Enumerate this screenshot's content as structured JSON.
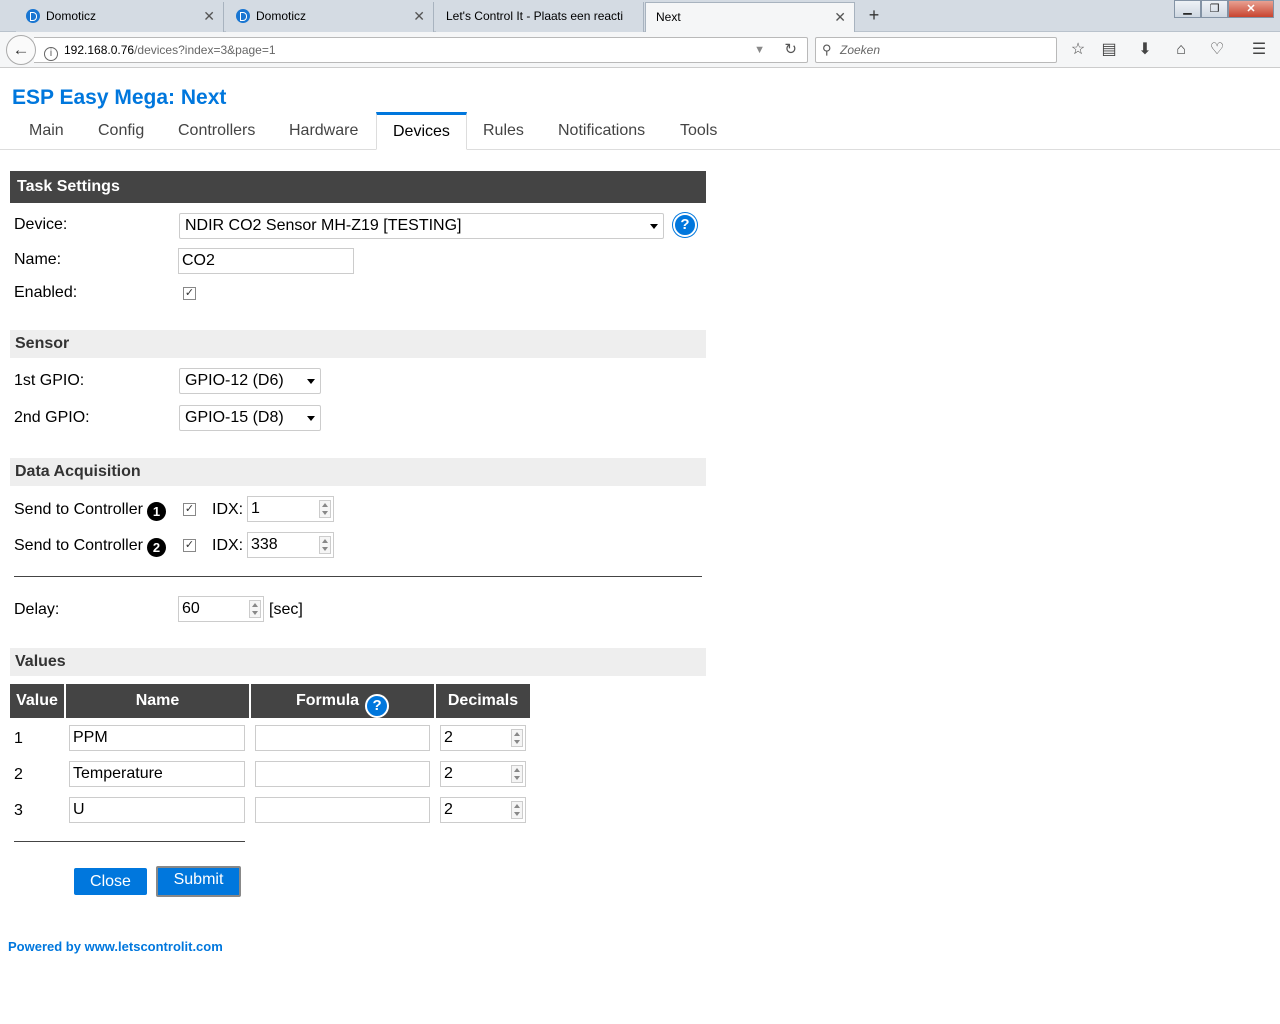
{
  "browser": {
    "tabs": [
      {
        "title": "Domoticz",
        "has_icon": true
      },
      {
        "title": "Domoticz",
        "has_icon": true
      },
      {
        "title": "Let's Control It - Plaats een reacti",
        "has_icon": false
      },
      {
        "title": "Next",
        "has_icon": false
      }
    ],
    "url_host": "192.168.0.76",
    "url_path": "/devices?index=3&page=1",
    "search_placeholder": "Zoeken"
  },
  "page": {
    "title": "ESP Easy Mega: Next",
    "menu": [
      "Main",
      "Config",
      "Controllers",
      "Hardware",
      "Devices",
      "Rules",
      "Notifications",
      "Tools"
    ],
    "active_menu": "Devices"
  },
  "task_settings": {
    "header": "Task Settings",
    "device_label": "Device:",
    "device_value": "NDIR CO2 Sensor MH-Z19 [TESTING]",
    "name_label": "Name:",
    "name_value": "CO2",
    "enabled_label": "Enabled:",
    "enabled": true
  },
  "sensor": {
    "header": "Sensor",
    "gpio1_label": "1st GPIO:",
    "gpio1_value": "GPIO-12 (D6)",
    "gpio2_label": "2nd GPIO:",
    "gpio2_value": "GPIO-15 (D8)"
  },
  "data_acquisition": {
    "header": "Data Acquisition",
    "controllers": [
      {
        "label": "Send to Controller",
        "number": "1",
        "checked": true,
        "idx_label": "IDX:",
        "idx_value": "1"
      },
      {
        "label": "Send to Controller",
        "number": "2",
        "checked": true,
        "idx_label": "IDX:",
        "idx_value": "338"
      }
    ],
    "delay_label": "Delay:",
    "delay_value": "60",
    "delay_unit": "[sec]"
  },
  "values": {
    "header": "Values",
    "columns": [
      "Value",
      "Name",
      "Formula",
      "Decimals"
    ],
    "rows": [
      {
        "value": "1",
        "name": "PPM",
        "formula": "",
        "decimals": "2"
      },
      {
        "value": "2",
        "name": "Temperature",
        "formula": "",
        "decimals": "2"
      },
      {
        "value": "3",
        "name": "U",
        "formula": "",
        "decimals": "2"
      }
    ]
  },
  "buttons": {
    "close": "Close",
    "submit": "Submit"
  },
  "footer": "Powered by www.letscontrolit.com",
  "colors": {
    "accent": "#0077dd",
    "header_dark": "#444444",
    "header_light": "#eeeeee"
  }
}
